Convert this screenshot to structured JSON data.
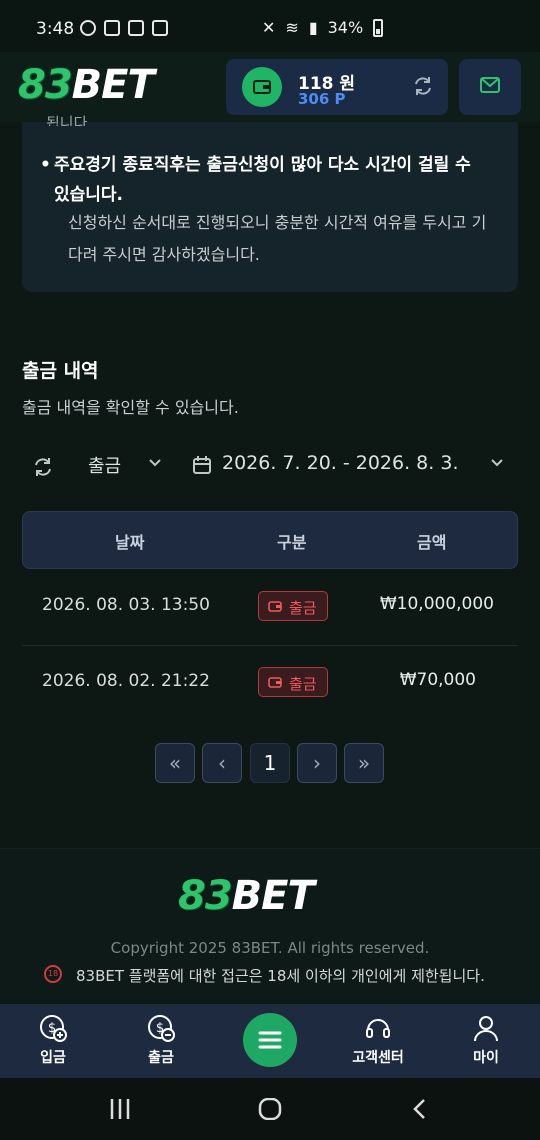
{
  "status_bar": {
    "time": "3:48",
    "battery": "34%"
  },
  "header": {
    "logo_number": "83",
    "logo_text": "BET",
    "balance_money": "118 원",
    "balance_points": "306 P"
  },
  "notice": {
    "cut_line": "됩니다.",
    "bullet": "주요경기 종료직후는 출금신청이 많아 다소 시간이 걸릴 수 있습니다.",
    "sub": "신청하신 순서대로 진행되오니 충분한 시간적 여유를 두시고 기다려 주시면 감사하겠습니다."
  },
  "section": {
    "title": "출금 내역",
    "description": "출금 내역을 확인할 수 있습니다."
  },
  "filters": {
    "type_selected": "출금",
    "date_range": "2026. 7. 20. - 2026. 8. 3."
  },
  "table": {
    "headers": [
      "날짜",
      "구분",
      "금액"
    ],
    "rows": [
      {
        "date": "2026. 08. 03. 13:50",
        "type": "출금",
        "amount": "₩10,000,000"
      },
      {
        "date": "2026. 08. 02. 21:22",
        "type": "출금",
        "amount": "₩70,000"
      }
    ]
  },
  "pagination": {
    "first": "«",
    "prev": "‹",
    "current": "1",
    "next": "›",
    "last": "»"
  },
  "footer": {
    "logo_number": "83",
    "logo_text": "BET",
    "copyright": "Copyright 2025 83BET. All rights reserved.",
    "age_badge": "18",
    "age_notice": "83BET 플랫폼에 대한 접근은 18세 이하의 개인에게 제한됩니다."
  },
  "bottom_nav": {
    "deposit": "입금",
    "withdraw": "출금",
    "support": "고객센터",
    "my": "마이"
  },
  "colors": {
    "accent_green": "#1fb564",
    "point_blue": "#4d8cf0",
    "badge_red": "#f05a5a",
    "nav_bg": "#1d2a40"
  }
}
